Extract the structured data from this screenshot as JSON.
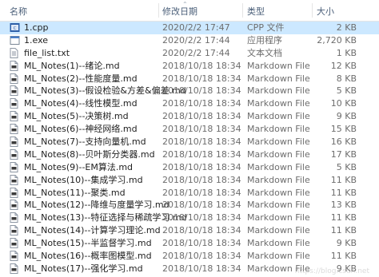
{
  "header": {
    "name": "名称",
    "date": "修改日期",
    "type": "类型",
    "size": "大小"
  },
  "files": [
    {
      "name": "1.cpp",
      "date": "2020/2/2 17:47",
      "type": "CPP 文件",
      "size": "2 KB",
      "icon": "cpp-file-icon",
      "selected": true
    },
    {
      "name": "1.exe",
      "date": "2020/2/2 17:44",
      "type": "应用程序",
      "size": "2,720 KB",
      "icon": "exe-icon"
    },
    {
      "name": "file_list.txt",
      "date": "2020/2/2 17:44",
      "type": "文本文档",
      "size": "1 KB",
      "icon": "text-file-icon"
    },
    {
      "name": "ML_Notes(1)--绪论.md",
      "date": "2018/10/18 18:34",
      "type": "Markdown File",
      "size": "12 KB",
      "icon": "markdown-file-icon"
    },
    {
      "name": "ML_Notes(2)--性能度量.md",
      "date": "2018/10/18 18:34",
      "type": "Markdown File",
      "size": "8 KB",
      "icon": "markdown-file-icon"
    },
    {
      "name": "ML_Notes(3)--假设检验&方差&偏差.md",
      "date": "2018/10/18 18:34",
      "type": "Markdown File",
      "size": "5 KB",
      "icon": "markdown-file-icon"
    },
    {
      "name": "ML_Notes(4)--线性模型.md",
      "date": "2018/10/18 18:34",
      "type": "Markdown File",
      "size": "10 KB",
      "icon": "markdown-file-icon"
    },
    {
      "name": "ML_Notes(5)--决策树.md",
      "date": "2018/10/18 18:34",
      "type": "Markdown File",
      "size": "9 KB",
      "icon": "markdown-file-icon"
    },
    {
      "name": "ML_Notes(6)--神经网络.md",
      "date": "2018/10/18 18:34",
      "type": "Markdown File",
      "size": "15 KB",
      "icon": "markdown-file-icon"
    },
    {
      "name": "ML_Notes(7)--支持向量机.md",
      "date": "2018/10/18 18:34",
      "type": "Markdown File",
      "size": "16 KB",
      "icon": "markdown-file-icon"
    },
    {
      "name": "ML_Notes(8)--贝叶斯分类器.md",
      "date": "2018/10/18 18:34",
      "type": "Markdown File",
      "size": "17 KB",
      "icon": "markdown-file-icon"
    },
    {
      "name": "ML_Notes(9)--EM算法.md",
      "date": "2018/10/18 18:34",
      "type": "Markdown File",
      "size": "5 KB",
      "icon": "markdown-file-icon"
    },
    {
      "name": "ML_Notes(10)--集成学习.md",
      "date": "2018/10/18 18:34",
      "type": "Markdown File",
      "size": "11 KB",
      "icon": "markdown-file-icon"
    },
    {
      "name": "ML_Notes(11)--聚类.md",
      "date": "2018/10/18 18:34",
      "type": "Markdown File",
      "size": "11 KB",
      "icon": "markdown-file-icon"
    },
    {
      "name": "ML_Notes(12)--降维与度量学习.md",
      "date": "2018/10/18 18:34",
      "type": "Markdown File",
      "size": "13 KB",
      "icon": "markdown-file-icon"
    },
    {
      "name": "ML_Notes(13)--特征选择与稀疏学习.md",
      "date": "2018/10/18 18:34",
      "type": "Markdown File",
      "size": "11 KB",
      "icon": "markdown-file-icon"
    },
    {
      "name": "ML_Notes(14)--计算学习理论.md",
      "date": "2018/10/18 18:34",
      "type": "Markdown File",
      "size": "11 KB",
      "icon": "markdown-file-icon"
    },
    {
      "name": "ML_Notes(15)--半监督学习.md",
      "date": "2018/10/18 18:34",
      "type": "Markdown File",
      "size": "9 KB",
      "icon": "markdown-file-icon"
    },
    {
      "name": "ML_Notes(16)--概率图模型.md",
      "date": "2018/10/18 18:34",
      "type": "Markdown File",
      "size": "11 KB",
      "icon": "markdown-file-icon"
    },
    {
      "name": "ML_Notes(17)--强化学习.md",
      "date": "2018/10/18 18:34",
      "type": "Markdown File",
      "size": "9 KB",
      "icon": "markdown-file-icon"
    }
  ],
  "colors": {
    "selected_row": "#cce8ff",
    "header_text": "#4c607a",
    "secondary_text": "#6d6d6d"
  }
}
